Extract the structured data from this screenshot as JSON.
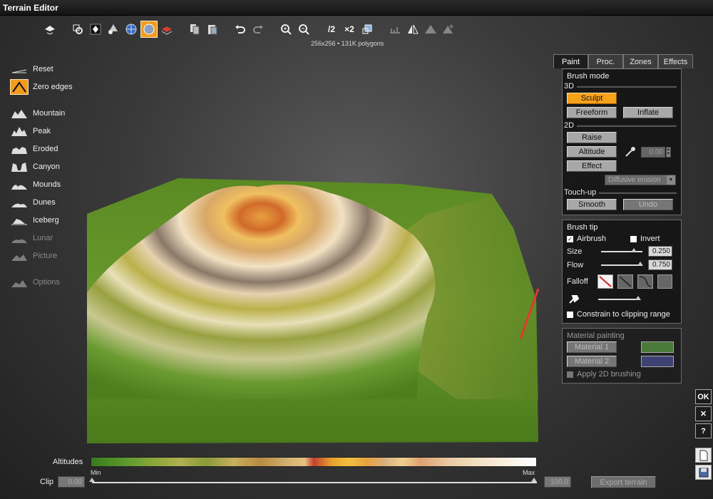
{
  "window": {
    "title": "Terrain Editor"
  },
  "toolbar": {
    "half_label": "/2",
    "double_label": "×2",
    "poly_info": "256x256 • 131K polygons"
  },
  "presets": {
    "reset": "Reset",
    "zero_edges": "Zero edges",
    "mountain": "Mountain",
    "peak": "Peak",
    "eroded": "Eroded",
    "canyon": "Canyon",
    "mounds": "Mounds",
    "dunes": "Dunes",
    "iceberg": "Iceberg",
    "lunar": "Lunar",
    "picture": "Picture",
    "options": "Options"
  },
  "tabs": [
    "Paint",
    "Proc.",
    "Zones",
    "Effects"
  ],
  "brush_mode": {
    "title": "Brush mode",
    "section_3d": "3D",
    "sculpt": "Sculpt",
    "freeform": "Freeform",
    "inflate": "Inflate",
    "section_2d": "2D",
    "raise": "Raise",
    "altitude": "Altitude",
    "altitude_value": "0.00",
    "effect": "Effect",
    "effect_option": "Diffusive erosion",
    "section_touchup": "Touch-up",
    "smooth": "Smooth",
    "undo": "Undo"
  },
  "brush_tip": {
    "title": "Brush tip",
    "airbrush": "Airbrush",
    "airbrush_checked": true,
    "invert": "Invert",
    "invert_checked": false,
    "size_label": "Size",
    "size_value": "0.250",
    "size_level": 0.8,
    "flow_label": "Flow",
    "flow_value": "0.750",
    "flow_level": 0.95,
    "falloff_label": "Falloff",
    "constrain": "Constrain to clipping range"
  },
  "material": {
    "title": "Material painting",
    "material1": "Material 1",
    "material1_color": "#4a7a3a",
    "material2": "Material 2",
    "material2_color": "#3e4272",
    "apply2d": "Apply 2D brushing"
  },
  "side_buttons": {
    "ok": "OK",
    "close": "✕",
    "help": "?"
  },
  "bottom": {
    "altitudes_label": "Altitudes",
    "min_label": "Min",
    "max_label": "Max",
    "clip_label": "Clip",
    "clip_min": "0.00",
    "clip_max": "100.0",
    "export": "Export terrain"
  },
  "colors": {
    "accent": "#f39b1c",
    "panel_bg": "#121212"
  }
}
